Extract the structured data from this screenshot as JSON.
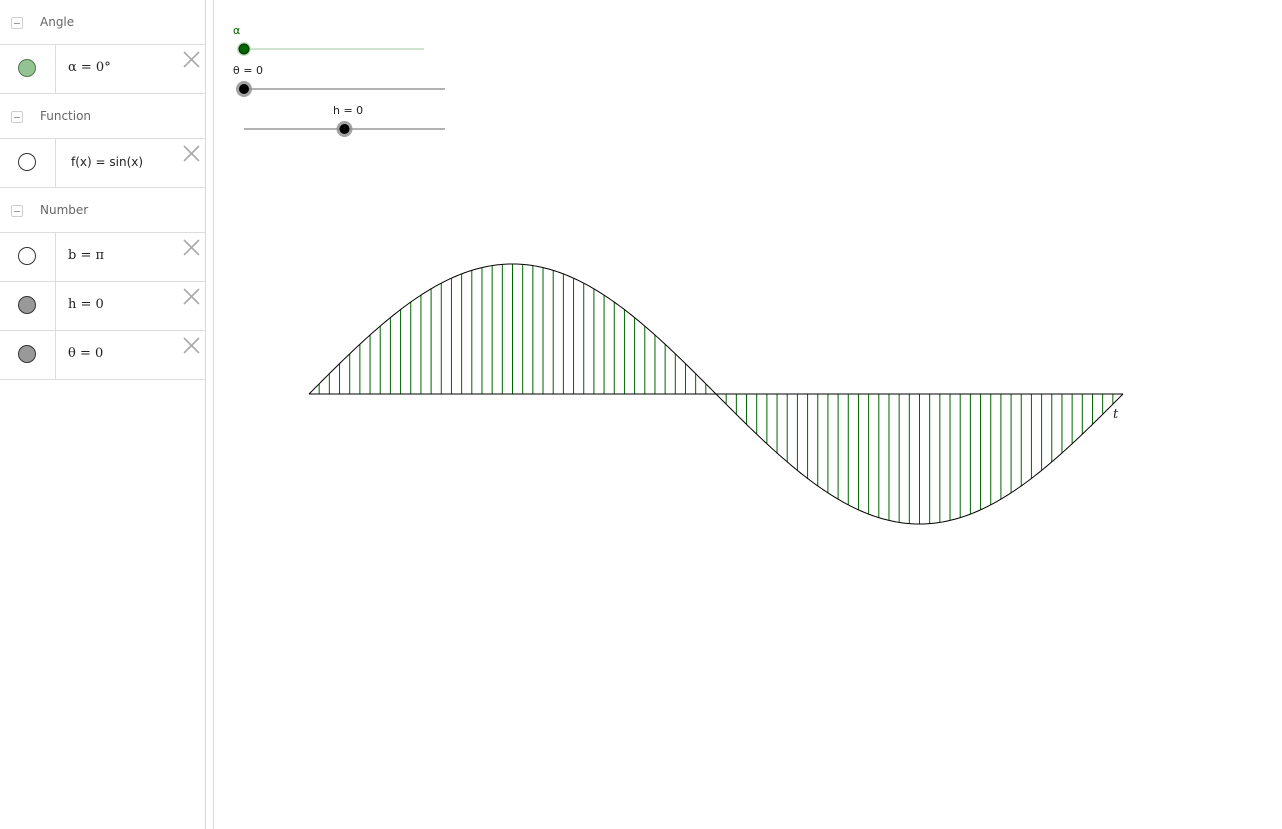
{
  "algebra": {
    "groups": [
      {
        "label": "Angle",
        "items": [
          {
            "formula": "α = 0°",
            "marble_color": "#93c393",
            "marble_filled": true
          }
        ]
      },
      {
        "label": "Function",
        "items": [
          {
            "formula": "f(x) = sin(x)",
            "marble_color": "#ffffff",
            "marble_filled": false
          }
        ]
      },
      {
        "label": "Number",
        "items": [
          {
            "formula": "b = π",
            "marble_color": "#ffffff",
            "marble_filled": false
          },
          {
            "formula": "h = 0",
            "marble_color": "#999999",
            "marble_filled": true
          },
          {
            "formula": "θ = 0",
            "marble_color": "#999999",
            "marble_filled": true
          }
        ]
      }
    ]
  },
  "graphics": {
    "sliders": {
      "alpha": {
        "label": "α",
        "color": "#006400",
        "fraction": 0.0
      },
      "theta": {
        "label": "θ = 0",
        "fraction": 0.0
      },
      "h": {
        "label": "h = 0",
        "fraction": 0.5
      }
    },
    "axis_label": "t",
    "fill_color": "#006400",
    "curve_color": "#000000"
  }
}
